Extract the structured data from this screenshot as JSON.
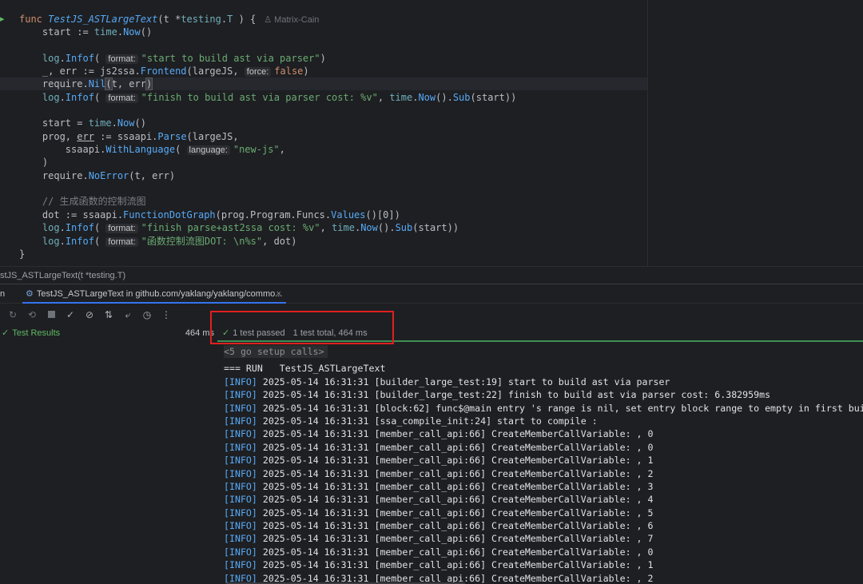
{
  "editor": {
    "author": "Matrix-Cain",
    "lines": [
      {
        "segments": [
          [
            "kw",
            "func "
          ],
          [
            "fn",
            "TestJS_ASTLargeText"
          ],
          [
            "",
            "(t *"
          ],
          [
            "ty",
            "testing"
          ],
          [
            "",
            "."
          ],
          [
            "ty",
            "T"
          ],
          [
            "",
            " ) {"
          ]
        ]
      },
      {
        "segments": [
          [
            "",
            "    start := "
          ],
          [
            "ty",
            "time"
          ],
          [
            "",
            "."
          ],
          [
            "cf",
            "Now"
          ],
          [
            "",
            "()"
          ]
        ]
      },
      {
        "segments": []
      },
      {
        "segments": [
          [
            "",
            "    "
          ],
          [
            "ty",
            "log"
          ],
          [
            "",
            "."
          ],
          [
            "cf",
            "Infof"
          ],
          [
            "",
            "( "
          ],
          [
            "hint",
            "format:"
          ],
          [
            "str",
            "\"start to build ast via parser\""
          ],
          [
            "",
            ")"
          ]
        ]
      },
      {
        "segments": [
          [
            "",
            "    _, err := js2ssa."
          ],
          [
            "cf",
            "Frontend"
          ],
          [
            "",
            "(largeJS, "
          ],
          [
            "hint",
            "force:"
          ],
          [
            "kw",
            "false"
          ],
          [
            "",
            ")"
          ]
        ]
      },
      {
        "segments": [
          [
            "",
            "    require."
          ],
          [
            "cf",
            "Nil"
          ],
          [
            "brk",
            "("
          ],
          [
            "",
            "t, err"
          ],
          [
            "brk",
            ")"
          ]
        ],
        "current": true
      },
      {
        "segments": [
          [
            "",
            "    "
          ],
          [
            "ty",
            "log"
          ],
          [
            "",
            "."
          ],
          [
            "cf",
            "Infof"
          ],
          [
            "",
            "( "
          ],
          [
            "hint",
            "format:"
          ],
          [
            "str",
            "\"finish to build ast via parser cost: %v\""
          ],
          [
            "",
            ", "
          ],
          [
            "ty",
            "time"
          ],
          [
            "",
            "."
          ],
          [
            "cf",
            "Now"
          ],
          [
            "",
            "()."
          ],
          [
            "cf",
            "Sub"
          ],
          [
            "",
            "(start))"
          ]
        ]
      },
      {
        "segments": []
      },
      {
        "segments": [
          [
            "",
            "    start = "
          ],
          [
            "ty",
            "time"
          ],
          [
            "",
            "."
          ],
          [
            "cf",
            "Now"
          ],
          [
            "",
            "()"
          ]
        ]
      },
      {
        "segments": [
          [
            "",
            "    prog, "
          ],
          [
            "ul",
            "err"
          ],
          [
            "",
            " := ssaapi."
          ],
          [
            "cf",
            "Parse"
          ],
          [
            "",
            "(largeJS,"
          ]
        ]
      },
      {
        "segments": [
          [
            "",
            "        ssaapi."
          ],
          [
            "cf",
            "WithLanguage"
          ],
          [
            "",
            "( "
          ],
          [
            "hint",
            "language:"
          ],
          [
            "str",
            "\"new-js\""
          ],
          [
            "",
            ","
          ]
        ]
      },
      {
        "segments": [
          [
            "",
            "    )"
          ]
        ]
      },
      {
        "segments": [
          [
            "",
            "    require."
          ],
          [
            "cf",
            "NoError"
          ],
          [
            "",
            "(t, err)"
          ]
        ]
      },
      {
        "segments": []
      },
      {
        "segments": [
          [
            "cm",
            "    // 生成函数的控制流图"
          ]
        ]
      },
      {
        "segments": [
          [
            "",
            "    dot := ssaapi."
          ],
          [
            "cf",
            "FunctionDotGraph"
          ],
          [
            "",
            "(prog.Program.Funcs."
          ],
          [
            "cf",
            "Values"
          ],
          [
            "",
            "()[0])"
          ]
        ]
      },
      {
        "segments": [
          [
            "",
            "    "
          ],
          [
            "ty",
            "log"
          ],
          [
            "",
            "."
          ],
          [
            "cf",
            "Infof"
          ],
          [
            "",
            "( "
          ],
          [
            "hint",
            "format:"
          ],
          [
            "str",
            "\"finish parse+ast2ssa cost: %v\""
          ],
          [
            "",
            ", "
          ],
          [
            "ty",
            "time"
          ],
          [
            "",
            "."
          ],
          [
            "cf",
            "Now"
          ],
          [
            "",
            "()."
          ],
          [
            "cf",
            "Sub"
          ],
          [
            "",
            "(start))"
          ]
        ]
      },
      {
        "segments": [
          [
            "",
            "    "
          ],
          [
            "ty",
            "log"
          ],
          [
            "",
            "."
          ],
          [
            "cf",
            "Infof"
          ],
          [
            "",
            "( "
          ],
          [
            "hint",
            "format:"
          ],
          [
            "str",
            "\"函数控制流图DOT: \\n%s\""
          ],
          [
            "",
            ", dot)"
          ]
        ]
      },
      {
        "segments": [
          [
            "",
            "}"
          ]
        ]
      }
    ]
  },
  "breadcrumb": "stJS_ASTLargeText(t *testing.T)",
  "toolwindow": {
    "run_label": "n",
    "tab_label": "TestJS_ASTLargeText in github.com/yaklang/yaklang/commo...",
    "tab_close": "×",
    "toolbar_icons": [
      "rerun-failed-icon",
      "rerun-icon",
      "stop-icon",
      "show-passed-icon",
      "show-ignored-icon",
      "sort-icon",
      "import-icon",
      "history-icon",
      "more-icon"
    ],
    "tree": {
      "label": "Test Results",
      "duration": "464 ms"
    },
    "status": {
      "passed": "1 test passed",
      "total": "1 test total, 464 ms"
    },
    "console": {
      "setup": "<5 go setup calls>",
      "run_line": "=== RUN   TestJS_ASTLargeText",
      "logs": [
        {
          "level": "[INFO]",
          "text": " 2025-05-14 16:31:31 [builder_large_test:19] start to build ast via parser"
        },
        {
          "level": "[INFO]",
          "text": " 2025-05-14 16:31:31 [builder_large_test:22] finish to build ast via parser cost: 6.382959ms"
        },
        {
          "level": "[INFO]",
          "text": " 2025-05-14 16:31:31 [block:62] func$@main entry 's range is nil, set entry block range to empty in first building"
        },
        {
          "level": "[INFO]",
          "text": " 2025-05-14 16:31:31 [ssa_compile_init:24] start to compile :"
        },
        {
          "level": "[INFO]",
          "text": " 2025-05-14 16:31:31 [member_call_api:66] CreateMemberCallVariable: , 0"
        },
        {
          "level": "[INFO]",
          "text": " 2025-05-14 16:31:31 [member_call_api:66] CreateMemberCallVariable: , 0"
        },
        {
          "level": "[INFO]",
          "text": " 2025-05-14 16:31:31 [member_call_api:66] CreateMemberCallVariable: , 1"
        },
        {
          "level": "[INFO]",
          "text": " 2025-05-14 16:31:31 [member_call_api:66] CreateMemberCallVariable: , 2"
        },
        {
          "level": "[INFO]",
          "text": " 2025-05-14 16:31:31 [member_call_api:66] CreateMemberCallVariable: , 3"
        },
        {
          "level": "[INFO]",
          "text": " 2025-05-14 16:31:31 [member_call_api:66] CreateMemberCallVariable: , 4"
        },
        {
          "level": "[INFO]",
          "text": " 2025-05-14 16:31:31 [member_call_api:66] CreateMemberCallVariable: , 5"
        },
        {
          "level": "[INFO]",
          "text": " 2025-05-14 16:31:31 [member_call_api:66] CreateMemberCallVariable: , 6"
        },
        {
          "level": "[INFO]",
          "text": " 2025-05-14 16:31:31 [member_call_api:66] CreateMemberCallVariable: , 7"
        },
        {
          "level": "[INFO]",
          "text": " 2025-05-14 16:31:31 [member_call_api:66] CreateMemberCallVariable: , 0"
        },
        {
          "level": "[INFO]",
          "text": " 2025-05-14 16:31:31 [member_call_api:66] CreateMemberCallVariable: , 1"
        },
        {
          "level": "[INFO]",
          "text": " 2025-05-14 16:31:31 [member_call_api:66] CreateMemberCallVariable: , 2"
        }
      ]
    }
  },
  "colors": {
    "accent": "#3574f0",
    "passed": "#5fb865",
    "highlight_box": "#e02020",
    "info": "#57aaf7"
  }
}
